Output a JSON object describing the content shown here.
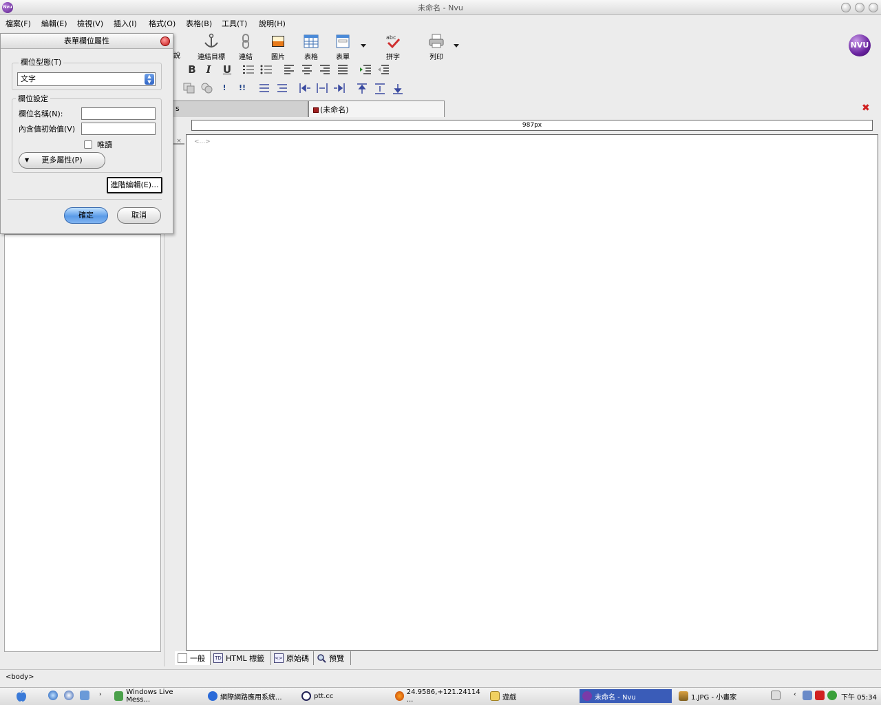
{
  "window": {
    "title": "未命名 - Nvu",
    "app_icon_label": "Nvu"
  },
  "menubar": {
    "items": [
      "檔案(F)",
      "編輯(E)",
      "檢視(V)",
      "插入(I)",
      "格式(O)",
      "表格(B)",
      "工具(T)",
      "說明(H)"
    ]
  },
  "toolbar": {
    "partial_label": "說",
    "buttons": [
      {
        "label": "連結目標",
        "icon": "anchor-icon"
      },
      {
        "label": "連結",
        "icon": "link-icon"
      },
      {
        "label": "圖片",
        "icon": "image-icon"
      },
      {
        "label": "表格",
        "icon": "table-icon"
      },
      {
        "label": "表單",
        "icon": "form-icon"
      },
      {
        "label": "拼字",
        "icon": "spellcheck-icon"
      },
      {
        "label": "列印",
        "icon": "printer-icon"
      }
    ],
    "logo_text": "NVU"
  },
  "format_toolbar": {
    "bold": "B",
    "italic": "I",
    "underline": "U",
    "bang": "!",
    "double_bang": "!!"
  },
  "tabs": {
    "other_partial": "s",
    "active": "(未命名)"
  },
  "ruler": {
    "width_label": "987px"
  },
  "editor": {
    "tag_marker": "<...>"
  },
  "view_tabs": [
    {
      "label": "一般",
      "icon": "page-icon",
      "glyph": ""
    },
    {
      "label": "HTML 標籤",
      "icon": "td-icon",
      "glyph": "TD"
    },
    {
      "label": "原始碼",
      "icon": "source-icon",
      "glyph": "<>"
    },
    {
      "label": "預覽",
      "icon": "magnifier-icon",
      "glyph": ""
    }
  ],
  "status": {
    "text": "<body>"
  },
  "dialog": {
    "title": "表單欄位屬性",
    "field_type_legend": "欄位型態(T)",
    "field_type_value": "文字",
    "field_settings_legend": "欄位設定",
    "field_name_label": "欄位名稱(N):",
    "field_name_value": "",
    "initial_value_label": "內含值初始值(V)",
    "initial_value": "",
    "readonly_label": "唯讀",
    "readonly_checked": false,
    "more_props_label": "更多屬性(P)",
    "advanced_edit_label": "進階編輯(E)...",
    "ok_label": "確定",
    "cancel_label": "取消"
  },
  "taskbar": {
    "tasks": [
      {
        "label": "Windows Live Mess...",
        "icon": "messenger-icon"
      },
      {
        "label": "網際網路應用系統...",
        "icon": "ie-icon"
      },
      {
        "label": "ptt.cc",
        "icon": "terminal-icon"
      },
      {
        "label": "24.9586,+121.24114 ...",
        "icon": "firefox-icon"
      },
      {
        "label": "遊戲",
        "icon": "folder-icon"
      },
      {
        "label": "未命名 - Nvu",
        "icon": "nvu-icon",
        "active": true
      },
      {
        "label": "1.JPG - 小畫家",
        "icon": "paint-icon"
      }
    ],
    "clock": "下午 05:34"
  },
  "colors": {
    "accent": "#3a5cb8",
    "nvu_purple": "#6a24a0",
    "close_red": "#c41414"
  }
}
